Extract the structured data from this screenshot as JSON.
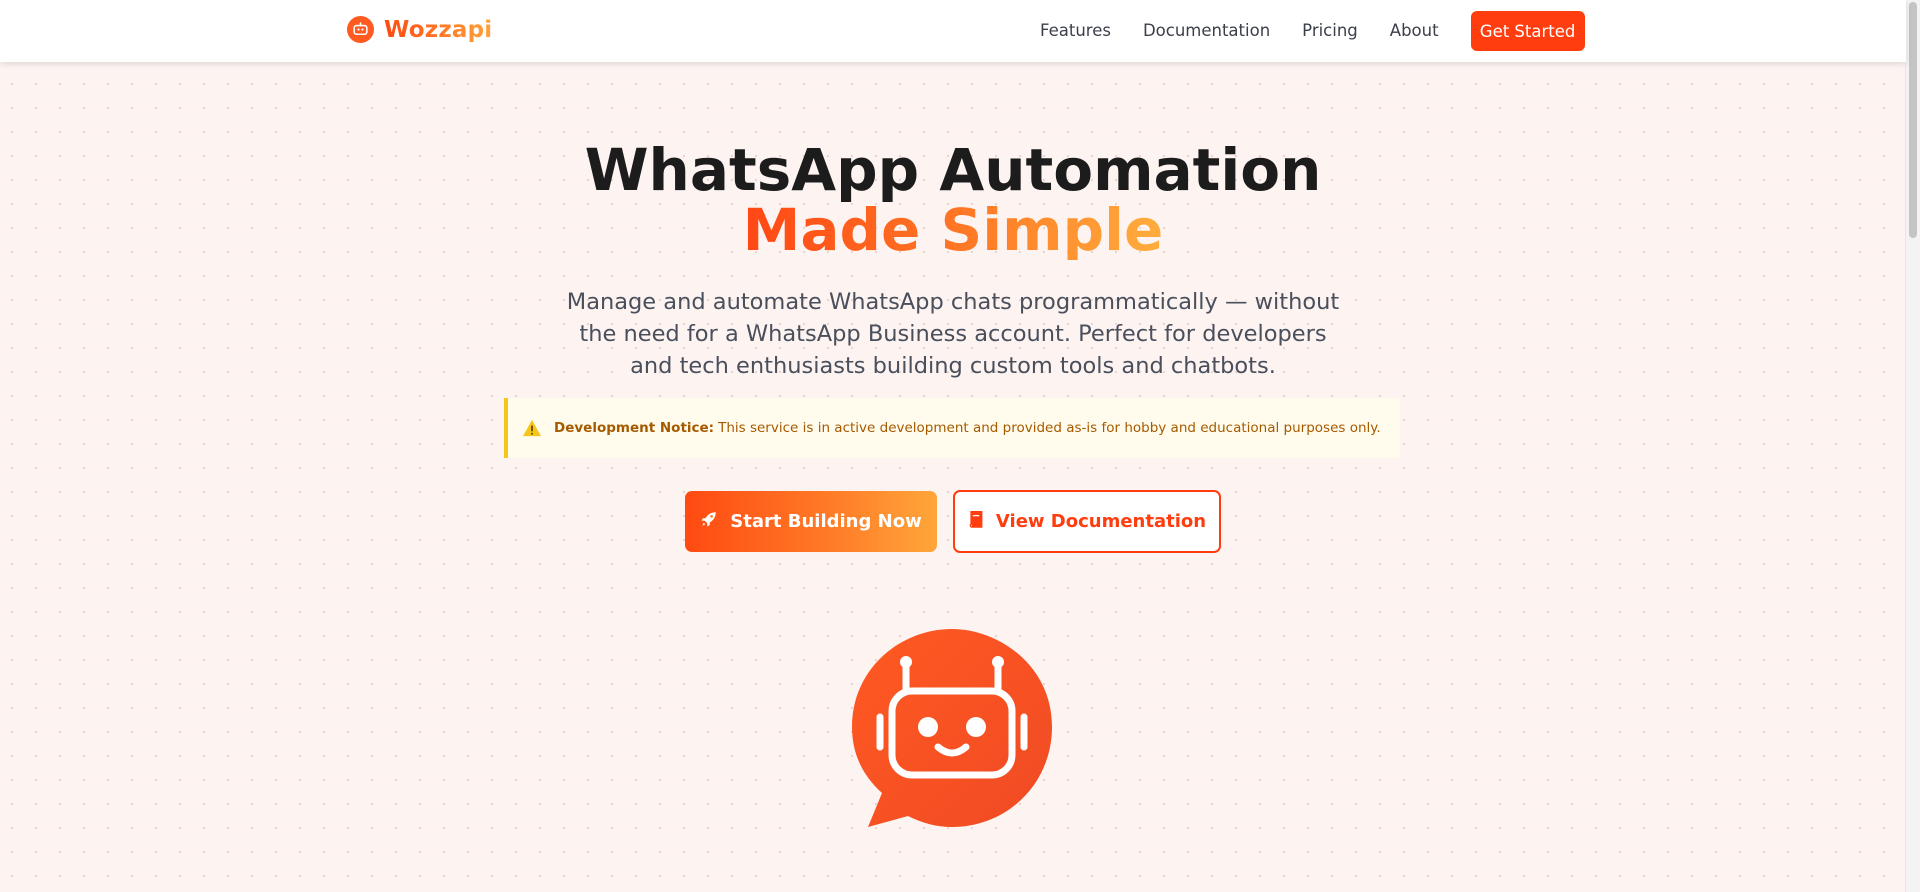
{
  "brand": {
    "name": "Wozzapi",
    "accent": "#ff3d0e",
    "gradient_start": "#ff4a12",
    "gradient_end": "#ffa63a"
  },
  "nav": {
    "links": [
      "Features",
      "Documentation",
      "Pricing",
      "About"
    ],
    "cta_label": "Get Started"
  },
  "hero": {
    "title_line1": "WhatsApp Automation",
    "title_line2": "Made Simple",
    "subtitle": "Manage and automate WhatsApp chats programmatically — without the need for a WhatsApp Business account. Perfect for developers and tech enthusiasts building custom tools and chatbots."
  },
  "notice": {
    "icon": "warning-icon",
    "label": "Development Notice:",
    "text": "This service is in active development and provided as-is for hobby and educational purposes only."
  },
  "buttons": {
    "primary_label": "Start Building Now",
    "primary_icon": "rocket-icon",
    "secondary_label": "View Documentation",
    "secondary_icon": "book-icon"
  },
  "illustration": {
    "icon": "chatbot-bubble-icon"
  }
}
